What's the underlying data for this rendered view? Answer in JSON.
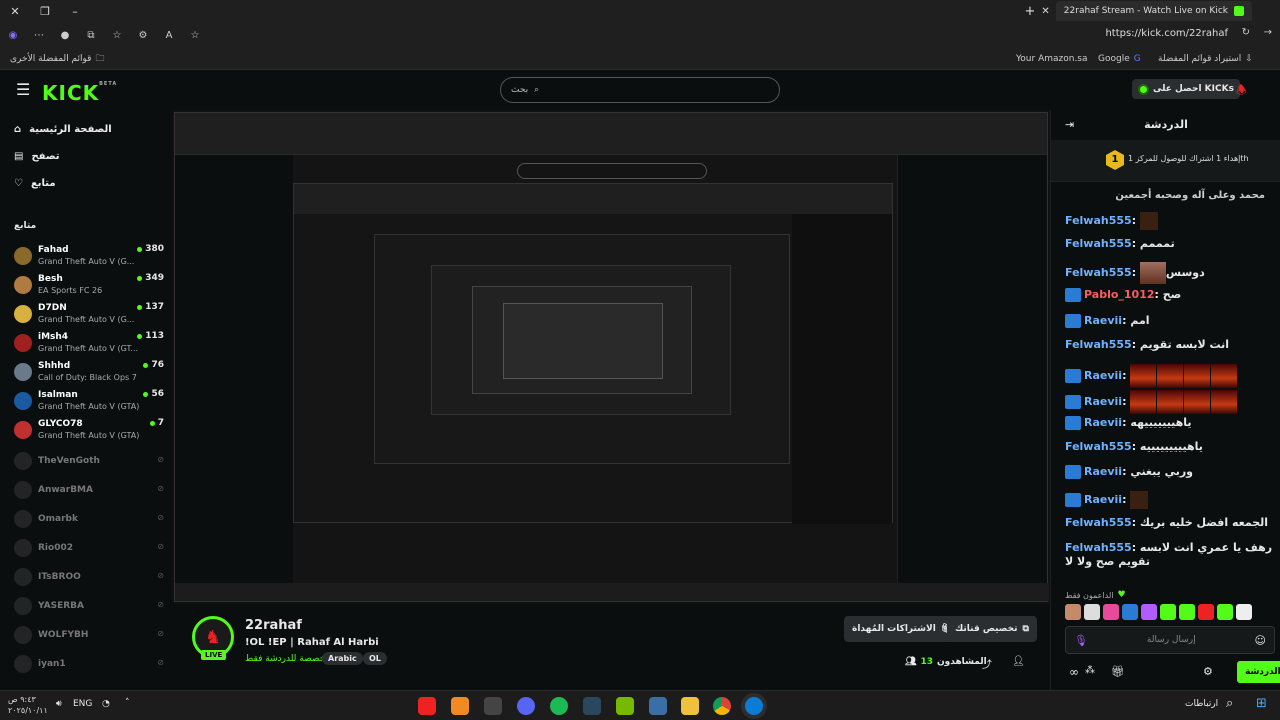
{
  "browser": {
    "tab_title": "22rahaf Stream - Watch Live on Kick",
    "url": "https://kick.com/22rahaf",
    "bookmarks_other": "قوائم المفضلة الأخرى",
    "bookmarks_right": [
      "Your Amazon.sa",
      "Google",
      "استيراد قوائم المفضلة"
    ]
  },
  "header": {
    "logo": "KICK",
    "logo_beta": "BETA",
    "search_placeholder": "بحث",
    "get_kicks": "احصل على KICKs"
  },
  "sidebar": {
    "nav": [
      {
        "label": "الصفحة الرئيسية",
        "icon": "home-icon"
      },
      {
        "label": "تصفح",
        "icon": "browse-icon"
      },
      {
        "label": "متابع",
        "icon": "heart-icon"
      }
    ],
    "section_title": "متابع",
    "following": [
      {
        "name": "Fahad",
        "game": "Grand Theft Auto V (G...",
        "viewers": "380",
        "color": "#8a6a2a"
      },
      {
        "name": "Besh",
        "game": "EA Sports FC 26",
        "viewers": "349",
        "color": "#b07a40"
      },
      {
        "name": "D7DN",
        "game": "Grand Theft Auto V (G...",
        "viewers": "137",
        "color": "#d8b040"
      },
      {
        "name": "iMsh4",
        "game": "Grand Theft Auto V (GT...",
        "viewers": "113",
        "color": "#a02020"
      },
      {
        "name": "Shhhd",
        "game": "Call of Duty: Black Ops 7",
        "viewers": "76",
        "color": "#6a7a8a"
      },
      {
        "name": "Isalman",
        "game": "Grand Theft Auto V (GTA)",
        "viewers": "56",
        "color": "#1a5aa0"
      },
      {
        "name": "GLYCO78",
        "game": "Grand Theft Auto V (GTA)",
        "viewers": "7",
        "color": "#c03030"
      }
    ],
    "offline": [
      "TheVenGoth",
      "AnwarBMA",
      "Omarbk",
      "Rio002",
      "ITsBROO",
      "YASERBA",
      "WOLFYBH",
      "iyan1"
    ]
  },
  "stream": {
    "channel": "22rahaf",
    "title": "!OL !EP | Rahaf Al Harbi",
    "subtitle": "مخصصة للدردشة فقط",
    "tags": [
      "Arabic",
      "OL"
    ],
    "gift_subs": "الاشتراكات المُهداة",
    "customize": "تخصيص قناتك",
    "viewers_label": "المشاهدون",
    "viewers": "13",
    "live": "LIVE"
  },
  "chat": {
    "title": "الدردشة",
    "pinned": "إهداء 1 اشتراك للوصول للمركز 1",
    "pinned_user": "th",
    "pinned_rank": "1",
    "top_partial": "محمد وعلى آله وصحبه أجمعين",
    "messages": [
      {
        "user": "Felwah555",
        "color": "blue",
        "badge": false,
        "text": "",
        "emote": "small"
      },
      {
        "user": "Felwah555",
        "color": "blue",
        "badge": false,
        "text": "تمممم"
      },
      {
        "user": "Felwah555",
        "color": "blue",
        "badge": false,
        "text": "دوسس",
        "emote": "face"
      },
      {
        "user": "Pablo_1012",
        "color": "red",
        "badge": true,
        "text": "صح"
      },
      {
        "user": "Raevii",
        "color": "blue",
        "badge": true,
        "text": "امم"
      },
      {
        "user": "Felwah555",
        "color": "blue",
        "badge": false,
        "text": "انت لابسه تقويم"
      },
      {
        "user": "Raevii",
        "color": "blue",
        "badge": true,
        "text": "",
        "emote": "row"
      },
      {
        "user": "Raevii",
        "color": "blue",
        "badge": true,
        "text": "",
        "emote": "row"
      },
      {
        "user": "Raevii",
        "color": "blue",
        "badge": true,
        "text": "ياهيييييييهه"
      },
      {
        "user": "Felwah555",
        "color": "blue",
        "badge": false,
        "text": "ياهيييييييييه"
      },
      {
        "user": "Raevii",
        "color": "blue",
        "badge": true,
        "text": "وربي يبغني"
      },
      {
        "user": "Raevii",
        "color": "blue",
        "badge": true,
        "text": "",
        "emote": "small"
      },
      {
        "user": "Felwah555",
        "color": "blue",
        "badge": false,
        "text": "الجمعه افضل خليه بريك"
      },
      {
        "user": "Felwah555",
        "color": "blue",
        "badge": false,
        "text": "رهف يا عمري انت لابسه تقويم صح ولا لا"
      }
    ],
    "supporters_label": "الداعمون فقط",
    "input_placeholder": "إرسال رسالة",
    "send_button": "الدردشة"
  },
  "taskbar": {
    "time": "٩:٤٣ ص",
    "date": "٢٠٢٥/١٠/١١",
    "lang": "ENG",
    "network_label": "ارتباطات"
  }
}
